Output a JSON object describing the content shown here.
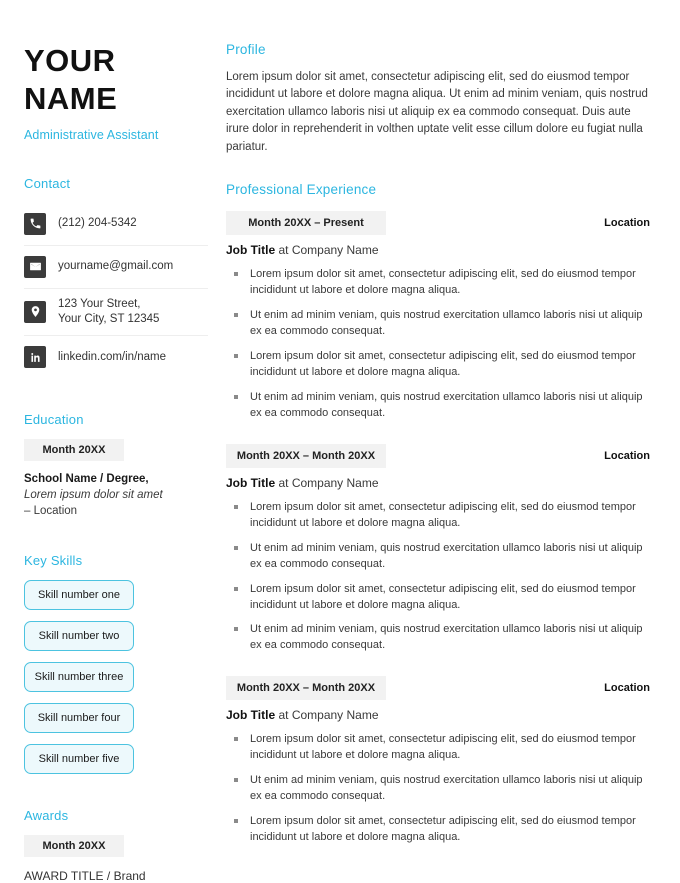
{
  "header": {
    "name_line_1": "YOUR",
    "name_line_2": "NAME",
    "job_role": "Administrative Assistant"
  },
  "sidebar": {
    "contact": {
      "heading": "Contact",
      "items": [
        {
          "icon": "phone-icon",
          "text": "(212) 204-5342"
        },
        {
          "icon": "email-icon",
          "text": "yourname@gmail.com"
        },
        {
          "icon": "location-pin-icon",
          "text_line_1": "123 Your Street,",
          "text_line_2": "Your City, ST 12345"
        },
        {
          "icon": "linkedin-icon",
          "text": "linkedin.com/in/name"
        }
      ]
    },
    "education": {
      "heading": "Education",
      "date": "Month 20XX",
      "school": "School Name / Degree,",
      "subtitle": "Lorem ipsum dolor sit amet",
      "location": "– Location"
    },
    "key_skills": {
      "heading": "Key Skills",
      "items": [
        "Skill number one",
        "Skill number two",
        "Skill number three",
        "Skill number four",
        "Skill number five"
      ]
    },
    "awards": {
      "heading": "Awards",
      "date": "Month 20XX",
      "title": "AWARD TITLE / Brand"
    }
  },
  "main": {
    "profile": {
      "heading": "Profile",
      "body": "Lorem ipsum dolor sit amet, consectetur adipiscing elit, sed do eiusmod tempor incididunt ut labore et dolore magna aliqua. Ut enim ad minim veniam, quis nostrud exercitation ullamco laboris nisi ut aliquip ex ea commodo consequat. Duis aute irure dolor in reprehenderit in volthen uptate velit esse cillum dolore eu fugiat nulla pariatur."
    },
    "experience": {
      "heading": "Professional Experience",
      "jobs": [
        {
          "dates": "Month 20XX – Present",
          "location": "Location",
          "title": "Job Title",
          "at": " at ",
          "company": "Company Name",
          "bullets": [
            "Lorem ipsum dolor sit amet, consectetur adipiscing elit, sed do eiusmod tempor incididunt ut labore et dolore magna aliqua.",
            "Ut enim ad minim veniam, quis nostrud exercitation ullamco laboris nisi ut aliquip ex ea commodo consequat.",
            "Lorem ipsum dolor sit amet, consectetur adipiscing elit, sed do eiusmod tempor incididunt ut labore et dolore magna aliqua.",
            "Ut enim ad minim veniam, quis nostrud exercitation ullamco laboris nisi ut aliquip ex ea commodo consequat."
          ]
        },
        {
          "dates": "Month 20XX – Month 20XX",
          "location": "Location",
          "title": "Job Title",
          "at": " at ",
          "company": "Company Name",
          "bullets": [
            "Lorem ipsum dolor sit amet, consectetur adipiscing elit, sed do eiusmod tempor incididunt ut labore et dolore magna aliqua.",
            "Ut enim ad minim veniam, quis nostrud exercitation ullamco laboris nisi ut aliquip ex ea commodo consequat.",
            "Lorem ipsum dolor sit amet, consectetur adipiscing elit, sed do eiusmod tempor incididunt ut labore et dolore magna aliqua.",
            "Ut enim ad minim veniam, quis nostrud exercitation ullamco laboris nisi ut aliquip ex ea commodo consequat."
          ]
        },
        {
          "dates": "Month 20XX – Month 20XX",
          "location": "Location",
          "title": "Job Title",
          "at": " at ",
          "company": "Company Name",
          "bullets": [
            "Lorem ipsum dolor sit amet, consectetur adipiscing elit, sed do eiusmod tempor incididunt ut labore et dolore magna aliqua.",
            "Ut enim ad minim veniam, quis nostrud exercitation ullamco laboris nisi ut aliquip ex ea commodo consequat.",
            "Lorem ipsum dolor sit amet, consectetur adipiscing elit, sed do eiusmod tempor incididunt ut labore et dolore magna aliqua."
          ]
        }
      ]
    }
  },
  "colors": {
    "accent": "#2cb6e0",
    "pill_border": "#4cc3e0",
    "pill_fill": "#edf9fc",
    "chip_fill": "#f2f2f2",
    "icon_tile": "#3b3b3b",
    "body_text": "#3a3a3a"
  }
}
